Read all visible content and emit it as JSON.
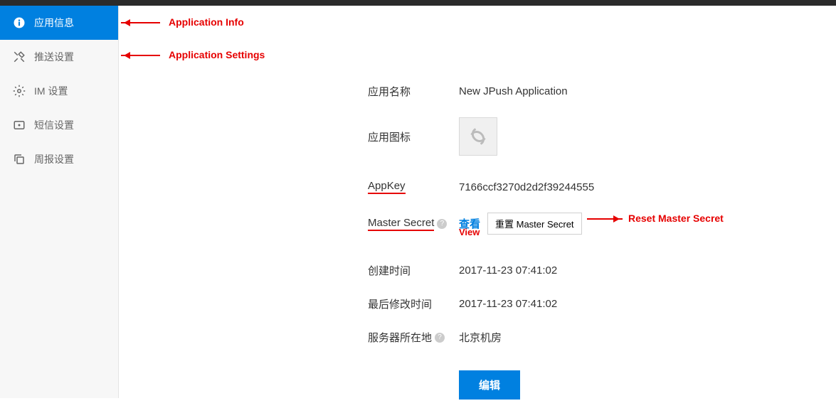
{
  "sidebar": {
    "items": [
      {
        "label": "应用信息"
      },
      {
        "label": "推送设置"
      },
      {
        "label": "IM 设置"
      },
      {
        "label": "短信设置"
      },
      {
        "label": "周报设置"
      }
    ]
  },
  "annotations": {
    "app_info": "Application Info",
    "app_settings": "Application Settings",
    "reset_master_secret": "Reset Master Secret",
    "view": "View"
  },
  "details": {
    "app_name_label": "应用名称",
    "app_name_value": "New JPush Application",
    "app_icon_label": "应用图标",
    "appkey_label": "AppKey",
    "appkey_value": "7166ccf3270d2d2f39244555",
    "master_secret_label": "Master Secret",
    "view_link": "查看",
    "reset_button": "重置 Master Secret",
    "created_label": "创建时间",
    "created_value": "2017-11-23 07:41:02",
    "modified_label": "最后修改时间",
    "modified_value": "2017-11-23 07:41:02",
    "server_label": "服务器所在地",
    "server_value": "北京机房",
    "edit_button": "编辑"
  }
}
